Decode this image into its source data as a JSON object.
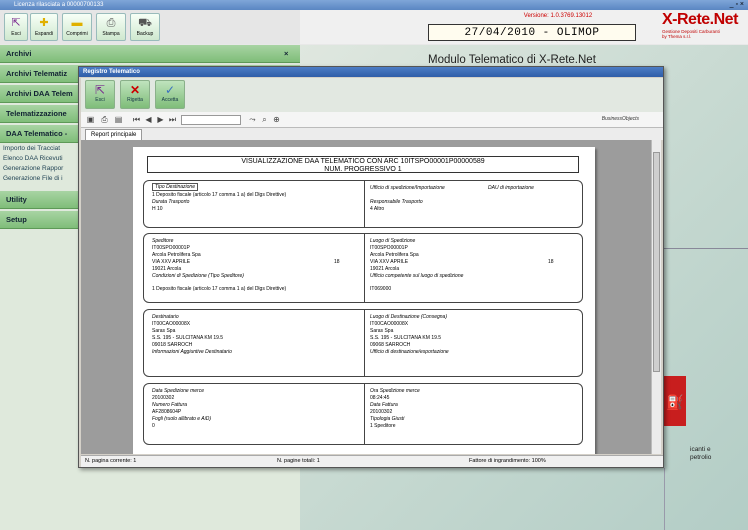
{
  "app": {
    "title_bar": "Licenza rilasciata a 00000700133",
    "window_controls": "_ ▫ ×"
  },
  "toolbar": {
    "buttons": [
      {
        "label": "Esci",
        "icon": "exit-icon"
      },
      {
        "label": "Espandi",
        "icon": "expand-icon"
      },
      {
        "label": "Comprimi",
        "icon": "collapse-icon"
      },
      {
        "label": "Stampa",
        "icon": "print-icon"
      },
      {
        "label": "Backup",
        "icon": "backup-icon"
      }
    ]
  },
  "header": {
    "version": "Versione: 1.0.3769.13012",
    "date_user": "27/04/2010 - OLIMOP",
    "logo_title": "X-Rete.Net",
    "logo_subtitle_1": "Gestione Depositi Carburanti",
    "logo_subtitle_2": "by Thema s.r.l."
  },
  "sidebar": {
    "sections": [
      {
        "label": "Archivi"
      },
      {
        "label": "Archivi Telematiz"
      },
      {
        "label": "Archivi DAA Telem"
      },
      {
        "label": "Telematizzazione"
      },
      {
        "label": "DAA Telematico -"
      },
      {
        "label": "Utility"
      },
      {
        "label": "Setup"
      }
    ],
    "subitems": [
      "Importo dei Tracciat",
      "Elenco DAA Ricevuti",
      "Generazione Rappor",
      "Generazione File di i"
    ],
    "archivi_close": "×"
  },
  "desktop": {
    "title": "Modulo Telematico di X-Rete.Net",
    "right_text_1": "icanti e",
    "right_text_2": "petrolio"
  },
  "dialog": {
    "title": "Registro Telematico",
    "buttons": [
      {
        "label": "Esci",
        "icon": "exit-icon"
      },
      {
        "label": "Rigetta",
        "icon": "reject-icon"
      },
      {
        "label": "Accetta",
        "icon": "accept-icon"
      }
    ],
    "viewer_toolbar": {
      "page_input_value": "",
      "zoom_icon": "binoculars-icon",
      "brand": "BusinessObjects"
    },
    "tab": "Report principale",
    "status": {
      "current_page": "N. pagina corrente: 1",
      "total_pages": "N. pagine totali: 1",
      "zoom": "Fattore di ingrandimento: 100%"
    }
  },
  "report": {
    "title_line1": "VISUALIZZAZIONE DAA TELEMATICO CON ARC 10ITSPO00001P00000589",
    "title_line2": "NUM. PROGRESSIVO 1",
    "s1": {
      "tipo_label": "Tipo Destinazione",
      "tipo_value": "1      Deposito fiscale (articolo 17 comma 1 a) del Dlgs Direttive)",
      "durata_label": "Durata Trasporto",
      "durata_value": "H      10",
      "ufficio_label": "Ufficio di spedizione/Importazione",
      "daa_label": "DAU di importazione",
      "resp_label": "Responsabile Trasporto",
      "resp_value": "4         Altro"
    },
    "s2": {
      "sped_label": "Speditore",
      "sped_code": "IT00SPO00001P",
      "sped_name": "Arcola Petrolifera Spa",
      "sped_addr": "VIA XXV APRILE",
      "sped_num": "18",
      "sped_cap": "19021          Arcola",
      "cond_label": "Condizioni di Spedizione (Tipo Speditore)",
      "cond_value": "1          Deposito fiscale (articolo 17 comma 1 a) del Dlgs Direttive)",
      "luogo_label": "Luogo di Spedizione",
      "luogo_code": "IT00SPO00001P",
      "luogo_name": "Arcola Petrolifera Spa",
      "luogo_addr": "VIA XXV APRILE",
      "luogo_num": "18",
      "luogo_cap": "19021          Arcola",
      "uff_label": "Ufficio competente sul luogo di spedizione",
      "uff_value": "IT069000"
    },
    "s3": {
      "dest_label": "Destinatario",
      "dest_code": "IT00CAO00008X",
      "dest_name": "Saras Spa",
      "dest_addr": "S.S. 195 - SULCITANA KM 19.5",
      "dest_cap": "09018                  SARROCH",
      "dest_info_label": "Informazioni Aggiuntive Destinatario",
      "ld_label": "Luogo di Destinazione (Consegna)",
      "ld_code": "IT00CAO00008X",
      "ld_name": "Saras Spa",
      "ld_addr": "S.S. 195 - SULCITANA KM 19.5",
      "ld_cap": "09068                  SARROCH",
      "ld_uff_label": "Ufficio di destinazione/esportazione"
    },
    "s4": {
      "data_label": "Data Spedizione merce",
      "data_value": "20100302",
      "fatt_label": "Numero Fattura",
      "fatt_value": "AF2808604P",
      "fogli_label": "Fogli (ruolo allibrato e AiD)",
      "fogli_value": "0",
      "ora_label": "Ora Spedizione merce",
      "ora_value": "08:24:45",
      "dfatt_label": "Data Fattura",
      "dfatt_value": "20100302",
      "tipo_label": "Tipologia Giusti",
      "tipo_value": "1              Speditore"
    }
  }
}
